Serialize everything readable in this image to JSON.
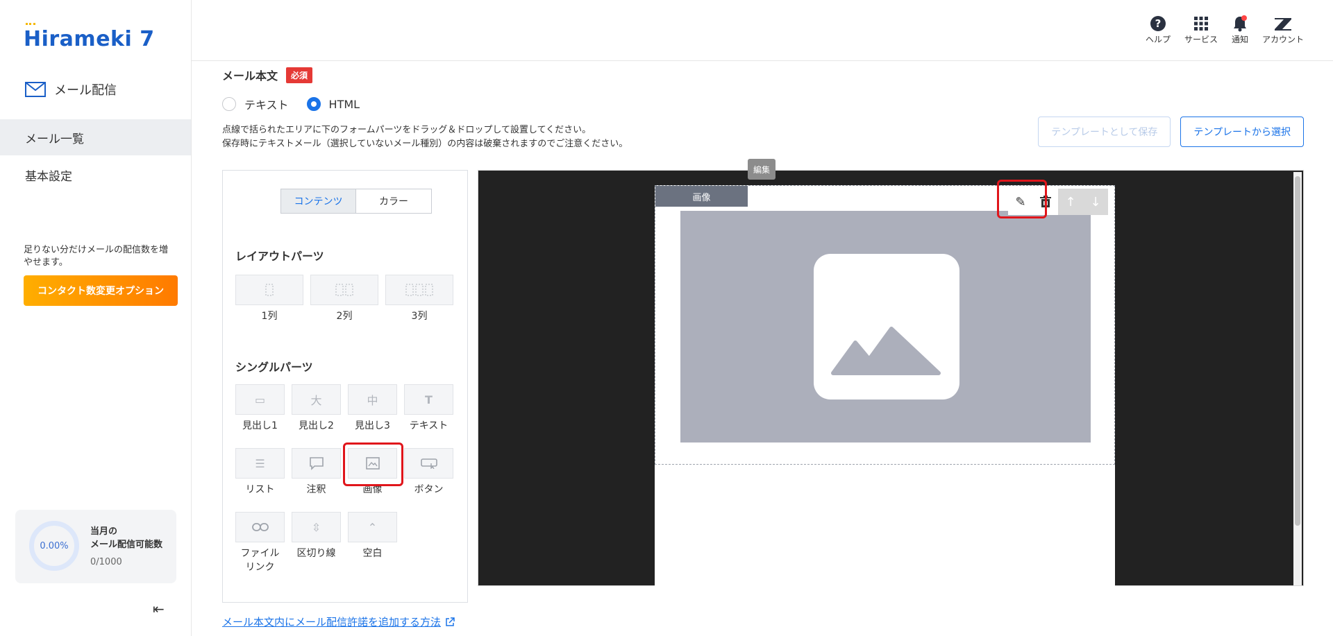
{
  "sidebar": {
    "logo_text": "Hirameki 7",
    "nav_title": "メール配信",
    "items": [
      {
        "label": "メール一覧"
      },
      {
        "label": "基本設定"
      }
    ],
    "note": "足りない分だけメールの配信数を増やせます。",
    "option_button": "コンタクト数変更オプション",
    "quota": {
      "percent": "0.00%",
      "label_line1": "当月の",
      "label_line2": "メール配信可能数",
      "count": "0/1000"
    },
    "collapse_icon": "collapse-left-icon"
  },
  "header": {
    "icons": [
      {
        "label": "ヘルプ",
        "icon": "help-icon"
      },
      {
        "label": "サービス",
        "icon": "grid-icon"
      },
      {
        "label": "通知",
        "icon": "bell-icon"
      },
      {
        "label": "アカウント",
        "icon": "zendesk-icon"
      }
    ]
  },
  "body_field": {
    "title": "メール本文",
    "required": "必須",
    "radio_text": "テキスト",
    "radio_html": "HTML",
    "selected": "HTML",
    "desc_line1": "点線で括られたエリアに下のフォームパーツをドラッグ＆ドロップして設置してください。",
    "desc_line2": "保存時にテキストメール（選択していないメール種別）の内容は破棄されますのでご注意ください。",
    "save_template": "テンプレートとして保存",
    "select_template": "テンプレートから選択",
    "help_link": "メール本文内にメール配信許諾を追加する方法"
  },
  "parts_panel": {
    "tab_contents": "コンテンツ",
    "tab_color": "カラー",
    "layout_title": "レイアウトパーツ",
    "layouts": [
      "1列",
      "2列",
      "3列"
    ],
    "single_title": "シングルパーツ",
    "singles": [
      {
        "label": "見出し1",
        "icon": "heading1-icon"
      },
      {
        "label": "見出し2",
        "icon": "heading2-icon"
      },
      {
        "label": "見出し3",
        "icon": "heading3-icon"
      },
      {
        "label": "テキスト",
        "icon": "text-icon"
      },
      {
        "label": "リスト",
        "icon": "list-icon"
      },
      {
        "label": "注釈",
        "icon": "comment-icon"
      },
      {
        "label": "画像",
        "icon": "image-icon"
      },
      {
        "label": "ボタン",
        "icon": "button-icon"
      },
      {
        "label": "ファイル\nリンク",
        "icon": "link-icon"
      },
      {
        "label": "区切り線",
        "icon": "divider-icon"
      },
      {
        "label": "空白",
        "icon": "spacer-icon"
      }
    ]
  },
  "editor": {
    "block_tag": "画像",
    "tooltip": "編集"
  }
}
